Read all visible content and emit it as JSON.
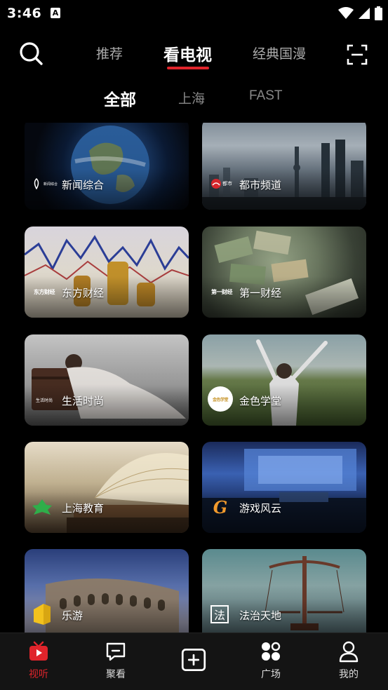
{
  "status_bar": {
    "time": "3:46",
    "notification_letter": "A",
    "icons": [
      "wifi-icon",
      "signal-icon",
      "battery-icon"
    ]
  },
  "top_nav": {
    "tabs": [
      {
        "label": "推荐",
        "active": false
      },
      {
        "label": "看电视",
        "active": true
      },
      {
        "label": "经典国漫",
        "active": false
      }
    ],
    "left_icon": "search-icon",
    "right_icon": "scan-icon"
  },
  "sub_tabs": [
    {
      "label": "全部",
      "active": true
    },
    {
      "label": "上海",
      "active": false
    },
    {
      "label": "FAST",
      "active": false
    }
  ],
  "channels": [
    {
      "name": "新闻综合",
      "logo_text": "新闻综合",
      "logo": "news-channel-logo"
    },
    {
      "name": "都市频道",
      "logo_text": "都市",
      "logo": "metro-channel-logo"
    },
    {
      "name": "东方财经",
      "logo_text": "东方财经",
      "logo": "oriental-finance-logo"
    },
    {
      "name": "第一财经",
      "logo_text": "第一财经",
      "logo": "yicai-logo"
    },
    {
      "name": "生活时尚",
      "logo_text": "生活时尚",
      "logo": "lifestyle-logo"
    },
    {
      "name": "金色学堂",
      "logo_text": "金色学堂",
      "logo": "golden-school-logo"
    },
    {
      "name": "上海教育",
      "logo_text": "",
      "logo": "shanghai-education-logo"
    },
    {
      "name": "游戏风云",
      "logo_text": "G",
      "logo": "game-channel-logo"
    },
    {
      "name": "乐游",
      "logo_text": "",
      "logo": "travel-channel-logo"
    },
    {
      "name": "法治天地",
      "logo_text": "法",
      "logo": "law-channel-logo"
    }
  ],
  "bottom_tabs": [
    {
      "label": "视听",
      "icon": "tv-icon",
      "active": true
    },
    {
      "label": "聚看",
      "icon": "chat-icon",
      "active": false
    },
    {
      "label": "",
      "icon": "add-icon",
      "active": false
    },
    {
      "label": "广场",
      "icon": "plaza-icon",
      "active": false
    },
    {
      "label": "我的",
      "icon": "profile-icon",
      "active": false
    }
  ],
  "colors": {
    "accent": "#e0242b",
    "background": "#000000",
    "tab_bar": "#141414",
    "inactive_text": "#aaaaaa"
  }
}
